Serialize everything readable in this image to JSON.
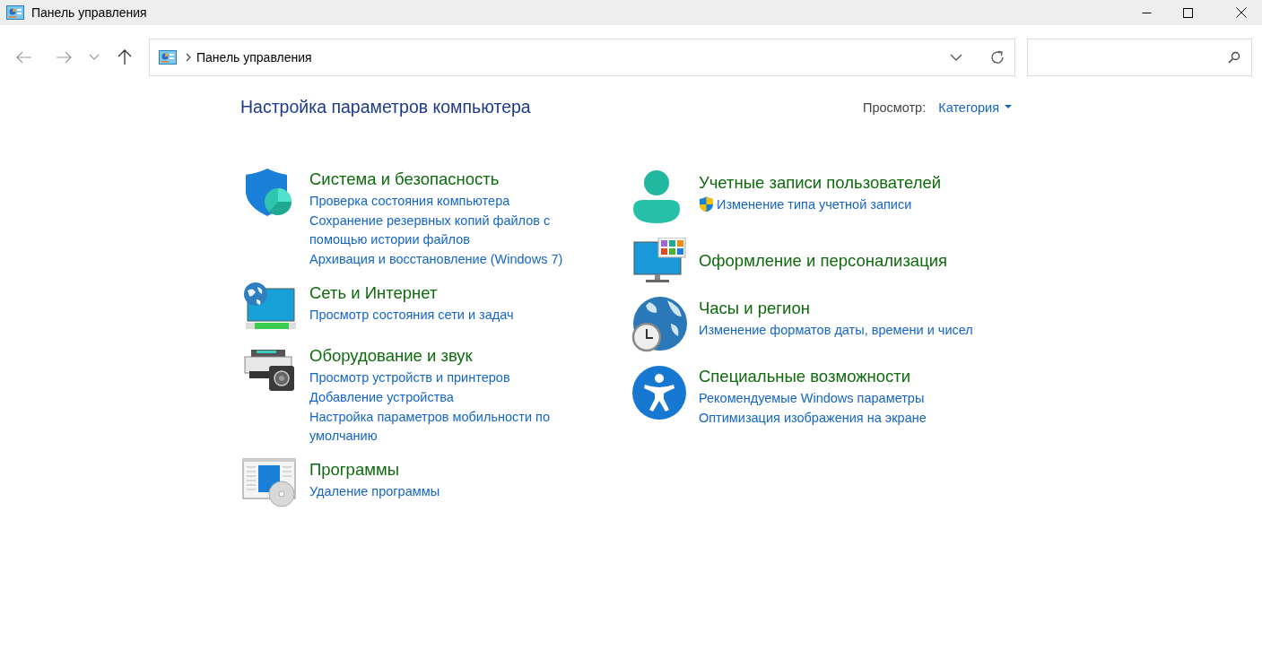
{
  "window": {
    "title": "Панель управления"
  },
  "address_bar": {
    "path": "Панель управления"
  },
  "heading": "Настройка параметров компьютера",
  "view": {
    "label": "Просмотр:",
    "value": "Категория"
  },
  "columns": [
    {
      "categories": [
        {
          "kind": "security",
          "title": "Система и безопасность",
          "links": [
            {
              "text": "Проверка состояния компьютера",
              "shield": false
            },
            {
              "text": "Сохранение резервных копий файлов с помощью истории файлов",
              "shield": false
            },
            {
              "text": "Архивация и восстановление (Windows 7)",
              "shield": false
            }
          ]
        },
        {
          "kind": "network",
          "title": "Сеть и Интернет",
          "links": [
            {
              "text": "Просмотр состояния сети и задач",
              "shield": false
            }
          ]
        },
        {
          "kind": "hardware",
          "title": "Оборудование и звук",
          "links": [
            {
              "text": "Просмотр устройств и принтеров",
              "shield": false
            },
            {
              "text": "Добавление устройства",
              "shield": false
            },
            {
              "text": "Настройка параметров мобильности по умолчанию",
              "shield": false
            }
          ]
        },
        {
          "kind": "programs",
          "title": "Программы",
          "links": [
            {
              "text": "Удаление программы",
              "shield": false
            }
          ]
        }
      ]
    },
    {
      "categories": [
        {
          "kind": "users",
          "title": "Учетные записи пользователей",
          "links": [
            {
              "text": "Изменение типа учетной записи",
              "shield": true
            }
          ]
        },
        {
          "kind": "appearance",
          "title": "Оформление и персонализация"
        },
        {
          "kind": "clock",
          "title": "Часы и регион",
          "links": [
            {
              "text": "Изменение форматов даты, времени и чисел",
              "shield": false
            }
          ]
        },
        {
          "kind": "accessibility",
          "title": "Специальные возможности",
          "links": [
            {
              "text": "Рекомендуемые Windows параметры",
              "shield": false
            },
            {
              "text": "Оптимизация изображения на экране",
              "shield": false
            }
          ]
        }
      ]
    }
  ]
}
